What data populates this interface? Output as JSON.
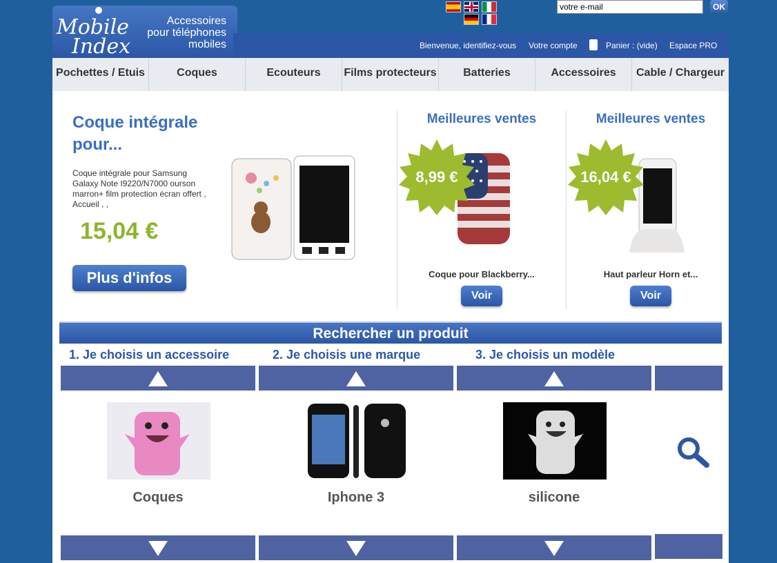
{
  "header": {
    "logo_text_1": "Mobile",
    "logo_text_2": "Index",
    "tagline": [
      "Accessoires",
      "pour téléphones",
      "mobiles"
    ],
    "email_placeholder": "votre e-mail",
    "ok_label": "OK",
    "welcome": "Bienvenue, identifiez-vous",
    "account": "Votre compte",
    "cart": "Panier : (vide)",
    "pro": "Espace PRO"
  },
  "nav": [
    "Pochettes / Etuis",
    "Coques",
    "Ecouteurs",
    "Films protecteurs",
    "Batteries",
    "Accessoires",
    "Cable / Chargeur"
  ],
  "featured": {
    "title": "Coque intégrale pour...",
    "description": "Coque intégrale pour Samsung Galaxy Note I9220/N7000 ourson marron+ film protection écran offert , Accueil , ,",
    "price": "15,04 €",
    "button": "Plus d'infos"
  },
  "best_sellers": [
    {
      "title": "Meilleures ventes",
      "price": "8,99 €",
      "name": "Coque pour Blackberry...",
      "button": "Voir"
    },
    {
      "title": "Meilleures ventes",
      "price": "16,04 €",
      "name": "Haut parleur Horn et...",
      "button": "Voir"
    }
  ],
  "search": {
    "title": "Rechercher un produit",
    "steps": [
      "1. Je choisis un accessoire",
      "2. Je choisis une marque",
      "3. Je choisis un modèle"
    ],
    "choices": [
      "Coques",
      "Iphone 3",
      "silicone"
    ]
  },
  "colors": {
    "brand": "#2c57a6",
    "price_green": "#8cb52c",
    "page_bg": "#1f5f9e"
  }
}
